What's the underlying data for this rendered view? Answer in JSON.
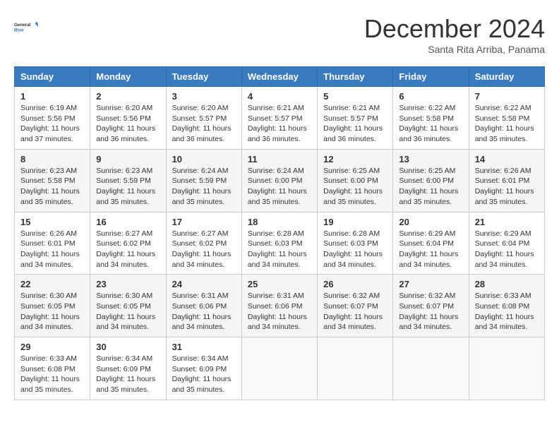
{
  "header": {
    "logo_line1": "General",
    "logo_line2": "Blue",
    "month_title": "December 2024",
    "location": "Santa Rita Arriba, Panama"
  },
  "weekdays": [
    "Sunday",
    "Monday",
    "Tuesday",
    "Wednesday",
    "Thursday",
    "Friday",
    "Saturday"
  ],
  "weeks": [
    [
      {
        "day": "1",
        "info": "Sunrise: 6:19 AM\nSunset: 5:56 PM\nDaylight: 11 hours\nand 37 minutes."
      },
      {
        "day": "2",
        "info": "Sunrise: 6:20 AM\nSunset: 5:56 PM\nDaylight: 11 hours\nand 36 minutes."
      },
      {
        "day": "3",
        "info": "Sunrise: 6:20 AM\nSunset: 5:57 PM\nDaylight: 11 hours\nand 36 minutes."
      },
      {
        "day": "4",
        "info": "Sunrise: 6:21 AM\nSunset: 5:57 PM\nDaylight: 11 hours\nand 36 minutes."
      },
      {
        "day": "5",
        "info": "Sunrise: 6:21 AM\nSunset: 5:57 PM\nDaylight: 11 hours\nand 36 minutes."
      },
      {
        "day": "6",
        "info": "Sunrise: 6:22 AM\nSunset: 5:58 PM\nDaylight: 11 hours\nand 36 minutes."
      },
      {
        "day": "7",
        "info": "Sunrise: 6:22 AM\nSunset: 5:58 PM\nDaylight: 11 hours\nand 35 minutes."
      }
    ],
    [
      {
        "day": "8",
        "info": "Sunrise: 6:23 AM\nSunset: 5:58 PM\nDaylight: 11 hours\nand 35 minutes."
      },
      {
        "day": "9",
        "info": "Sunrise: 6:23 AM\nSunset: 5:59 PM\nDaylight: 11 hours\nand 35 minutes."
      },
      {
        "day": "10",
        "info": "Sunrise: 6:24 AM\nSunset: 5:59 PM\nDaylight: 11 hours\nand 35 minutes."
      },
      {
        "day": "11",
        "info": "Sunrise: 6:24 AM\nSunset: 6:00 PM\nDaylight: 11 hours\nand 35 minutes."
      },
      {
        "day": "12",
        "info": "Sunrise: 6:25 AM\nSunset: 6:00 PM\nDaylight: 11 hours\nand 35 minutes."
      },
      {
        "day": "13",
        "info": "Sunrise: 6:25 AM\nSunset: 6:00 PM\nDaylight: 11 hours\nand 35 minutes."
      },
      {
        "day": "14",
        "info": "Sunrise: 6:26 AM\nSunset: 6:01 PM\nDaylight: 11 hours\nand 35 minutes."
      }
    ],
    [
      {
        "day": "15",
        "info": "Sunrise: 6:26 AM\nSunset: 6:01 PM\nDaylight: 11 hours\nand 34 minutes."
      },
      {
        "day": "16",
        "info": "Sunrise: 6:27 AM\nSunset: 6:02 PM\nDaylight: 11 hours\nand 34 minutes."
      },
      {
        "day": "17",
        "info": "Sunrise: 6:27 AM\nSunset: 6:02 PM\nDaylight: 11 hours\nand 34 minutes."
      },
      {
        "day": "18",
        "info": "Sunrise: 6:28 AM\nSunset: 6:03 PM\nDaylight: 11 hours\nand 34 minutes."
      },
      {
        "day": "19",
        "info": "Sunrise: 6:28 AM\nSunset: 6:03 PM\nDaylight: 11 hours\nand 34 minutes."
      },
      {
        "day": "20",
        "info": "Sunrise: 6:29 AM\nSunset: 6:04 PM\nDaylight: 11 hours\nand 34 minutes."
      },
      {
        "day": "21",
        "info": "Sunrise: 6:29 AM\nSunset: 6:04 PM\nDaylight: 11 hours\nand 34 minutes."
      }
    ],
    [
      {
        "day": "22",
        "info": "Sunrise: 6:30 AM\nSunset: 6:05 PM\nDaylight: 11 hours\nand 34 minutes."
      },
      {
        "day": "23",
        "info": "Sunrise: 6:30 AM\nSunset: 6:05 PM\nDaylight: 11 hours\nand 34 minutes."
      },
      {
        "day": "24",
        "info": "Sunrise: 6:31 AM\nSunset: 6:06 PM\nDaylight: 11 hours\nand 34 minutes."
      },
      {
        "day": "25",
        "info": "Sunrise: 6:31 AM\nSunset: 6:06 PM\nDaylight: 11 hours\nand 34 minutes."
      },
      {
        "day": "26",
        "info": "Sunrise: 6:32 AM\nSunset: 6:07 PM\nDaylight: 11 hours\nand 34 minutes."
      },
      {
        "day": "27",
        "info": "Sunrise: 6:32 AM\nSunset: 6:07 PM\nDaylight: 11 hours\nand 34 minutes."
      },
      {
        "day": "28",
        "info": "Sunrise: 6:33 AM\nSunset: 6:08 PM\nDaylight: 11 hours\nand 34 minutes."
      }
    ],
    [
      {
        "day": "29",
        "info": "Sunrise: 6:33 AM\nSunset: 6:08 PM\nDaylight: 11 hours\nand 35 minutes."
      },
      {
        "day": "30",
        "info": "Sunrise: 6:34 AM\nSunset: 6:09 PM\nDaylight: 11 hours\nand 35 minutes."
      },
      {
        "day": "31",
        "info": "Sunrise: 6:34 AM\nSunset: 6:09 PM\nDaylight: 11 hours\nand 35 minutes."
      },
      {
        "day": "",
        "info": ""
      },
      {
        "day": "",
        "info": ""
      },
      {
        "day": "",
        "info": ""
      },
      {
        "day": "",
        "info": ""
      }
    ]
  ]
}
